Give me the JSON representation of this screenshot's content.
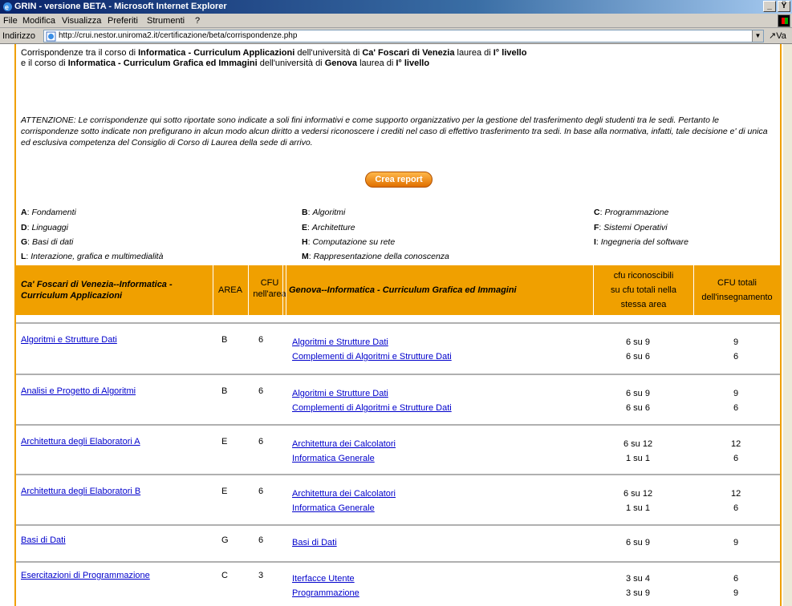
{
  "window": {
    "title": "GRIN - versione BETA - Microsoft Internet Explorer",
    "controls": [
      "_",
      "Ÿ"
    ]
  },
  "menu": [
    "File",
    "Modifica",
    "Visualizza",
    "Preferiti",
    "Strumenti",
    "?"
  ],
  "address": {
    "label": "Indirizzo",
    "url": "http://crui.nestor.uniroma2.it/certificazione/beta/corrispondenze.php",
    "go": "↗Va"
  },
  "intro": {
    "line1_a": "Corrispondenze tra il corso di ",
    "line1_b": "Informatica - Curriculum Applicazioni",
    "line1_c": " dell'università di ",
    "line1_d": "Ca' Foscari di Venezia",
    "line1_e": " laurea di ",
    "line1_f": "I° livello",
    "line2_a": "e il corso di ",
    "line2_b": "Informatica - Curriculum Grafica ed Immagini",
    "line2_c": " dell'università di ",
    "line2_d": "Genova",
    "line2_e": " laurea di ",
    "line2_f": "I° livello"
  },
  "warning": "ATTENZIONE: Le corrispondenze qui sotto riportate sono indicate a soli fini informativi e come supporto organizzativo per la gestione del trasferimento degli studenti tra le sedi. Pertanto le corrispondenze sotto indicate non prefigurano in alcun modo alcun diritto a vedersi riconoscere i crediti nel caso di effettivo trasferimento tra sedi. In base alla normativa, infatti, tale decisione e' di unica ed esclusiva competenza del Consiglio di Corso di Laurea della sede di arrivo.",
  "crea_report": "Crea report",
  "legend": [
    {
      "code": "A",
      "name": "Fondamenti"
    },
    {
      "code": "B",
      "name": "Algoritmi"
    },
    {
      "code": "C",
      "name": "Programmazione"
    },
    {
      "code": "D",
      "name": "Linguaggi"
    },
    {
      "code": "E",
      "name": "Architetture"
    },
    {
      "code": "F",
      "name": "Sistemi Operativi"
    },
    {
      "code": "G",
      "name": "Basi di dati"
    },
    {
      "code": "H",
      "name": "Computazione su rete"
    },
    {
      "code": "I",
      "name": "Ingegneria del software"
    },
    {
      "code": "L",
      "name": "Interazione, grafica e multimedialità"
    },
    {
      "code": "M",
      "name": "Rappresentazione della conoscenza"
    }
  ],
  "table_header": {
    "col1": "Ca' Foscari di Venezia--Informatica - Curriculum Applicazioni",
    "col2": "AREA",
    "col3_1": "CFU",
    "col3_2": "nell'area",
    "col4": "Genova--Informatica - Curriculum Grafica ed Immagini",
    "col5_1": "cfu riconoscibili",
    "col5_2": "su cfu totali nella",
    "col5_3": "stessa area",
    "col6_1": "CFU totali",
    "col6_2": "dell'insegnamento"
  },
  "rows": [
    {
      "course": "Algoritmi e Strutture Dati",
      "area": "B",
      "cfu": "6",
      "matches": [
        {
          "name": "Algoritmi e Strutture Dati",
          "ric": "6 su 9",
          "tot": "9"
        },
        {
          "name": "Complementi di Algoritmi e Strutture Dati",
          "ric": "6 su 6",
          "tot": "6"
        }
      ]
    },
    {
      "course": "Analisi e Progetto di Algoritmi",
      "area": "B",
      "cfu": "6",
      "matches": [
        {
          "name": "Algoritmi e Strutture Dati",
          "ric": "6 su 9",
          "tot": "9"
        },
        {
          "name": "Complementi di Algoritmi e Strutture Dati",
          "ric": "6 su 6",
          "tot": "6"
        }
      ]
    },
    {
      "course": "Architettura degli Elaboratori A",
      "area": "E",
      "cfu": "6",
      "matches": [
        {
          "name": "Architettura dei Calcolatori",
          "ric": "6 su 12",
          "tot": "12"
        },
        {
          "name": "Informatica Generale",
          "ric": "1 su 1",
          "tot": "6"
        }
      ]
    },
    {
      "course": "Architettura degli Elaboratori B",
      "area": "E",
      "cfu": "6",
      "matches": [
        {
          "name": "Architettura dei Calcolatori",
          "ric": "6 su 12",
          "tot": "12"
        },
        {
          "name": "Informatica Generale",
          "ric": "1 su 1",
          "tot": "6"
        }
      ]
    },
    {
      "course": "Basi di Dati",
      "area": "G",
      "cfu": "6",
      "matches": [
        {
          "name": "Basi di Dati",
          "ric": "6 su 9",
          "tot": "9"
        }
      ]
    },
    {
      "course": "Esercitazioni di Programmazione",
      "area": "C",
      "cfu": "3",
      "matches": [
        {
          "name": "Iterfacce Utente",
          "ric": "3 su 4",
          "tot": "6"
        },
        {
          "name": "Programmazione",
          "ric": "3 su 9",
          "tot": "9"
        }
      ]
    }
  ]
}
